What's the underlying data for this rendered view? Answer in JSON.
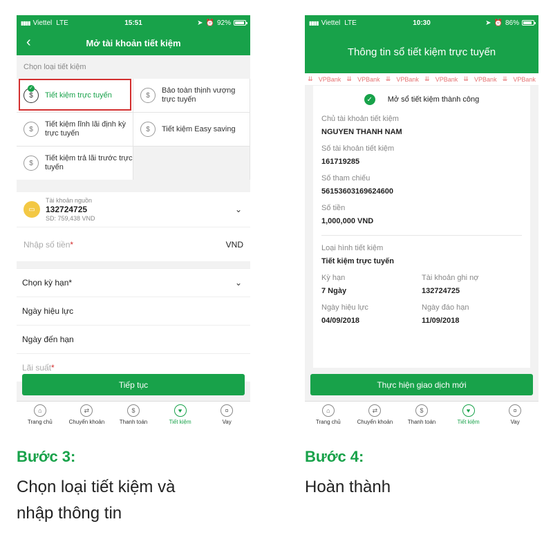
{
  "phone1": {
    "status": {
      "carrier": "Viettel",
      "network": "LTE",
      "time": "15:51",
      "battery": "92%",
      "battery_level": 0.92
    },
    "title": "Mở tài khoản tiết kiệm",
    "section_label": "Chọn loại tiết kiệm",
    "types": [
      {
        "label": "Tiết kiệm trực tuyến",
        "selected": true
      },
      {
        "label": "Bảo toàn thịnh vượng trực tuyến"
      },
      {
        "label": "Tiết kiệm lĩnh lãi định kỳ trực tuyến"
      },
      {
        "label": "Tiết kiệm Easy saving"
      },
      {
        "label": "Tiết kiệm trả lãi trước trực tuyến"
      }
    ],
    "source": {
      "label": "Tài khoản nguồn",
      "number": "132724725",
      "balance": "SD: 759,438 VND"
    },
    "amount": {
      "placeholder": "Nhập số tiền",
      "required": "*",
      "currency": "VND"
    },
    "term": {
      "label": "Chọn kỳ hạn",
      "required": "*"
    },
    "effective_date": "Ngày hiệu lực",
    "maturity_date": "Ngày đến hạn",
    "interest": {
      "label": "Lãi suất",
      "required": "*"
    },
    "continue": "Tiếp tục"
  },
  "phone2": {
    "status": {
      "carrier": "Viettel",
      "network": "LTE",
      "time": "10:30",
      "battery": "86%",
      "battery_level": 0.86
    },
    "title": "Thông tin sổ tiết kiệm trực tuyến",
    "watermark": "VPBank",
    "success": "Mở sổ tiết kiệm thành công",
    "holder_label": "Chủ tài khoản tiết kiệm",
    "holder": "NGUYEN THANH NAM",
    "account_label": "Số tài khoản tiết kiệm",
    "account": "161719285",
    "ref_label": "Số tham chiếu",
    "ref": "56153603169624600",
    "amount_label": "Số tiền",
    "amount": "1,000,000 VND",
    "type_label": "Loại hình tiết kiệm",
    "type": "Tiết kiệm trực tuyến",
    "term_label": "Kỳ hạn",
    "term": "7 Ngày",
    "debit_label": "Tài khoản ghi nợ",
    "debit": "132724725",
    "effective_label": "Ngày hiệu lực",
    "effective": "04/09/2018",
    "maturity_label": "Ngày đáo hạn",
    "maturity": "11/09/2018",
    "new_tx": "Thực hiện giao dịch mới"
  },
  "tabs": [
    {
      "label": "Trang chủ",
      "icon": "home-icon",
      "glyph": "⌂"
    },
    {
      "label": "Chuyển khoản",
      "icon": "transfer-icon",
      "glyph": "⇄"
    },
    {
      "label": "Thanh toán",
      "icon": "payment-icon",
      "glyph": "$"
    },
    {
      "label": "Tiết kiệm",
      "icon": "savings-icon",
      "glyph": "♥",
      "active": true
    },
    {
      "label": "Vay",
      "icon": "loan-icon",
      "glyph": "¤"
    }
  ],
  "captions": {
    "step3": "Bước 3:",
    "step3_desc_line1": "Chọn loại tiết kiệm và",
    "step3_desc_line2": "nhập thông tin",
    "step4": "Bước 4:",
    "step4_desc": "Hoàn thành"
  },
  "colors": {
    "primary": "#18a24a",
    "highlight": "#d32f2f",
    "watermark": "#e57373"
  }
}
